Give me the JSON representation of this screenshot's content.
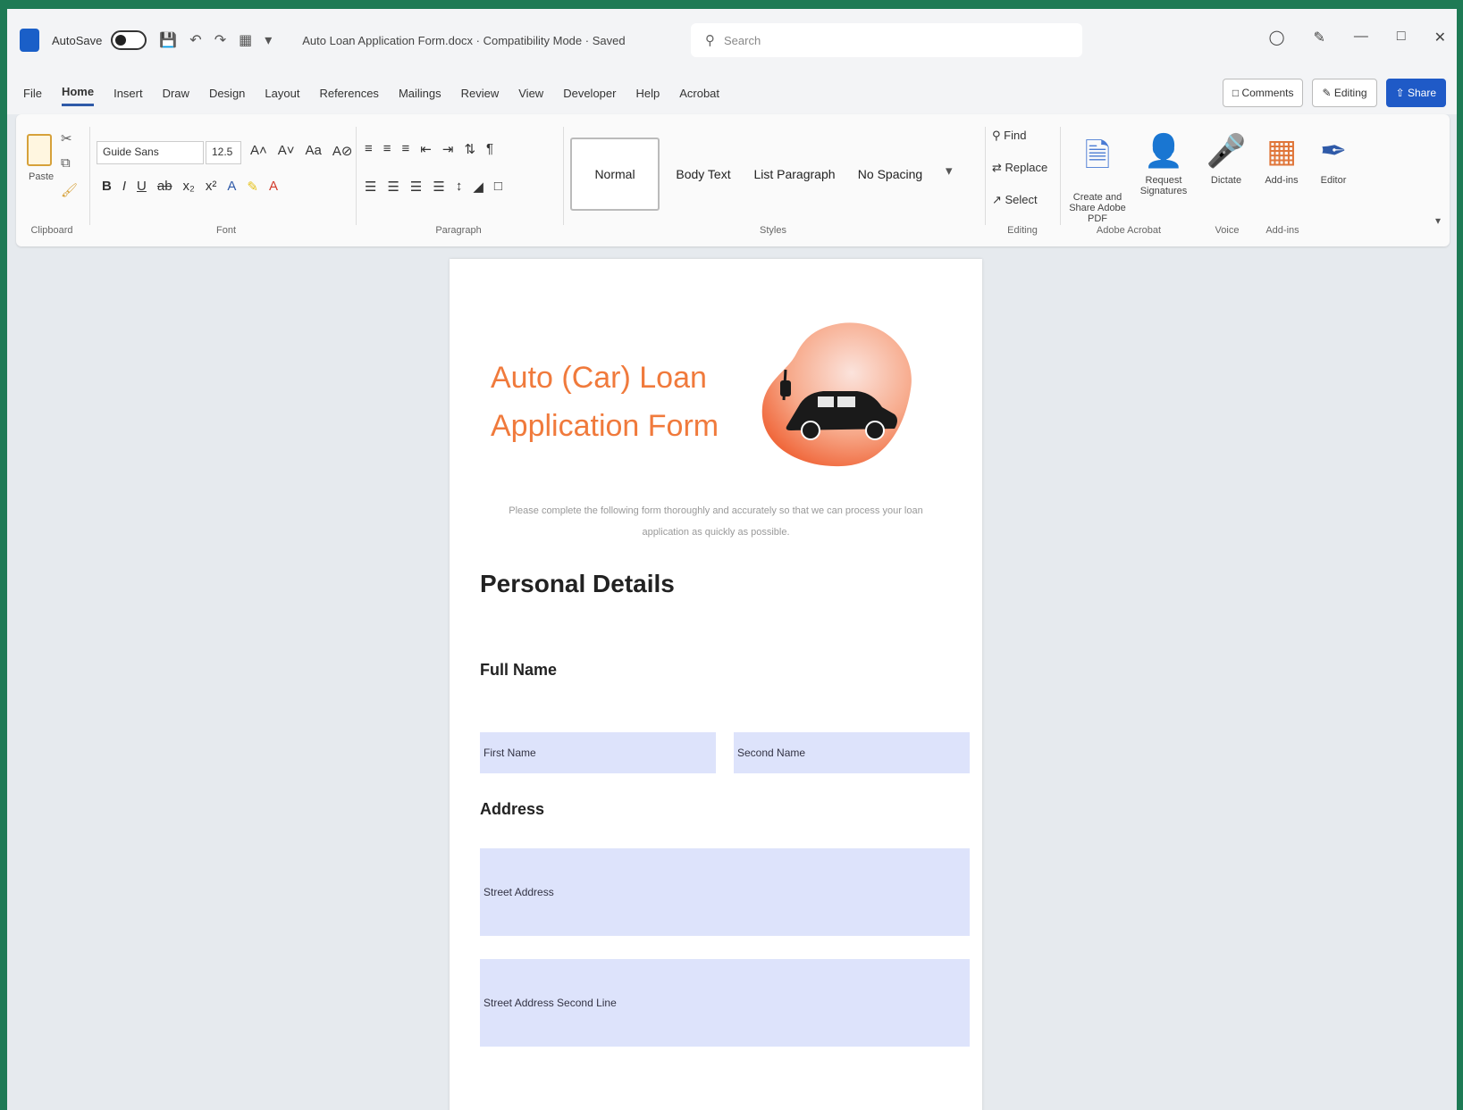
{
  "app": {
    "autosave_label": "AutoSave",
    "document_title": "Auto Loan Application Form.docx  ·  Compatibility Mode  ·  Saved",
    "search_placeholder": "Search"
  },
  "menu": {
    "tabs": [
      "File",
      "Home",
      "Insert",
      "Draw",
      "Design",
      "Layout",
      "References",
      "Mailings",
      "Review",
      "View",
      "Developer",
      "Help",
      "Acrobat"
    ],
    "active_tab": "Home",
    "comments_label": "Comments",
    "editing_label": "Editing",
    "share_label": "Share"
  },
  "ribbon": {
    "font_name": "Guide Sans",
    "font_size": "12.5",
    "paste_label": "Paste",
    "styles": [
      "Normal",
      "Body Text",
      "List Paragraph",
      "No Spacing"
    ],
    "editing_items": [
      "Find",
      "Replace",
      "Select"
    ],
    "tools": [
      {
        "label": "Create and Share Adobe PDF",
        "icon": "pdf-icon"
      },
      {
        "label": "Request Signatures",
        "icon": "signature-icon"
      },
      {
        "label": "Dictate",
        "icon": "microphone-icon"
      },
      {
        "label": "Add-ins",
        "icon": "addins-icon"
      },
      {
        "label": "Editor",
        "icon": "editor-icon"
      }
    ],
    "group_labels": [
      "Clipboard",
      "Font",
      "Paragraph",
      "Styles",
      "Editing",
      "Adobe Acrobat",
      "Voice",
      "Add-ins"
    ]
  },
  "document": {
    "heading_line1": "Auto (Car) Loan",
    "heading_line2": "Application Form",
    "intro": "Please complete the following form thoroughly and accurately so that we can process your loan application as quickly as possible.",
    "section_title": "Personal Details",
    "full_name_label": "Full Name",
    "first_name_placeholder": "First Name",
    "second_name_placeholder": "Second Name",
    "address_label": "Address",
    "street_address_placeholder": "Street Address",
    "street_address_2_placeholder": "Street Address Second Line"
  },
  "colors": {
    "heading": "#f07a3c",
    "field_bg": "#dde3fb",
    "frame": "#1e7a55",
    "share": "#1f5ac7"
  }
}
